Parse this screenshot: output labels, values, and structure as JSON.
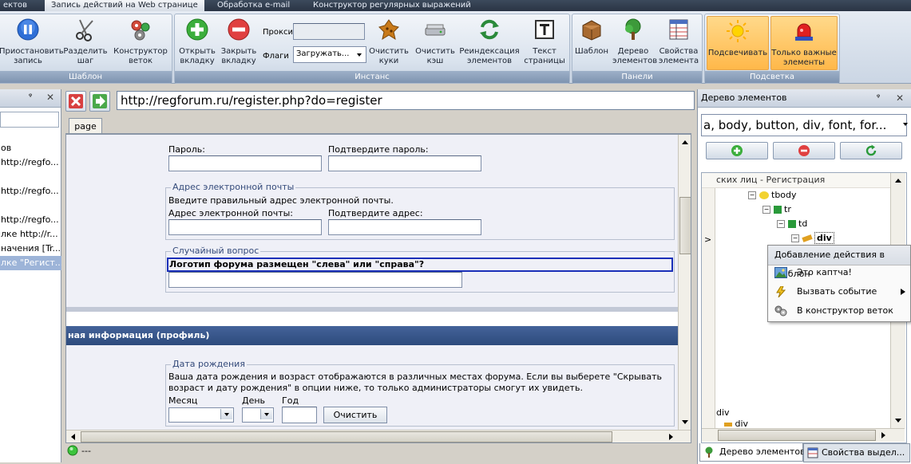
{
  "top_tabs": [
    {
      "label": "ектов",
      "active": false
    },
    {
      "label": "Запись действий на Web странице",
      "active": true
    },
    {
      "label": "Обработка e-mail",
      "active": false
    },
    {
      "label": "Конструктор регулярных выражений",
      "active": false
    }
  ],
  "ribbon": {
    "groups": {
      "template": "Шаблон",
      "instance": "Инстанс",
      "panels": "Панели",
      "highlight": "Подсветка"
    },
    "buttons": {
      "stop_record": [
        "Приостановить",
        "запись"
      ],
      "split_step": [
        "Разделить",
        "шаг"
      ],
      "branch_constructor": [
        "Конструктор",
        "веток"
      ],
      "open_tab": [
        "Открыть",
        "вкладку"
      ],
      "close_tab": [
        "Закрыть",
        "вкладку"
      ],
      "clear_cookies": [
        "Очистить",
        "куки"
      ],
      "clear_cache": [
        "Очистить",
        "кэш"
      ],
      "reindex": [
        "Реиндексация",
        "элементов"
      ],
      "page_text": [
        "Текст",
        "страницы"
      ],
      "template_panel": [
        "Шаблон",
        ""
      ],
      "element_tree": [
        "Дерево",
        "элементов"
      ],
      "element_props": [
        "Свойства",
        "элемента"
      ],
      "highlight": [
        "Подсвечивать",
        ""
      ],
      "important_only": [
        "Только важные",
        "элементы"
      ]
    },
    "proxy_label": "Прокси",
    "flags_label": "Флаги",
    "flags_value": "Загружать...",
    "proxy_value": ""
  },
  "left_panel": {
    "pin": "ᵠ",
    "close": "✕",
    "items": [
      "ов",
      "http://regfo...",
      "",
      "http://regfo...",
      "",
      "http://regfo...",
      "лке http://r...",
      "начения [Tr...",
      "лке \"Регист..."
    ]
  },
  "urlbar": {
    "url": "http://regforum.ru/register.php?do=register"
  },
  "page_tab": "page",
  "form": {
    "password_label": "Пароль:",
    "confirm_password_label": "Подтвердите пароль:",
    "email_legend": "Адрес электронной почты",
    "email_hint": "Введите правильный адрес электронной почты.",
    "email_label": "Адрес электронной почты:",
    "confirm_email_label": "Подтвердите адрес:",
    "random_legend": "Случайный вопрос",
    "random_question": "Логотип форума размещен \"слева\" или \"справа\"?",
    "profile_header": "ная информация (профиль)",
    "birth_legend": "Дата рождения",
    "birth_text_1": "Ваша дата рождения и возраст отображаются в различных местах форума. Если вы выберете \"Скрывать",
    "birth_text_2": "возраст и дату рождения\" в опции ниже, то только администраторы смогут их увидеть.",
    "month_label": "Месяц",
    "day_label": "День",
    "year_label": "Год",
    "clear_button": "Очистить"
  },
  "status": {
    "text": "---"
  },
  "right_panel": {
    "title": "Дерево элементов",
    "filter_value": "a, body, button, div, font, for...",
    "tree": {
      "root": "ских лиц - Регистрация",
      "tbody": "tbody",
      "tr": "tr",
      "td": "td",
      "div": "div",
      "div_bottom": "div",
      "div_bottom2": "div"
    },
    "expand_marker": ">"
  },
  "context_menu": {
    "header": "Добавление действия в шаблон",
    "items": [
      {
        "label": "Это каптча!",
        "icon": "image-icon"
      },
      {
        "label": "Вызвать событие",
        "icon": "event-icon",
        "submenu": true
      },
      {
        "label": "В конструктор веток",
        "icon": "branch-icon"
      }
    ]
  },
  "bottom_tabs": [
    {
      "label": "Дерево элементов",
      "active": true
    },
    {
      "label": "Свойства выдел...",
      "active": false
    }
  ],
  "colors": {
    "accent": "#7e93b0",
    "highlight": "#ffb84a",
    "profile_bar": "#2d4a7c"
  }
}
